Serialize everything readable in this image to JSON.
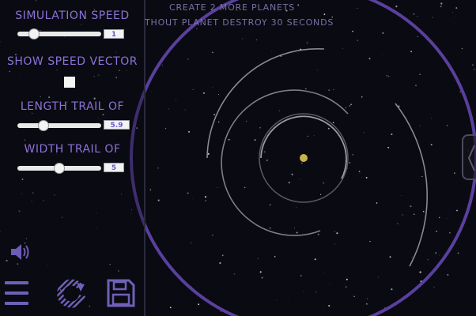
{
  "hint": {
    "line1": "CREATE 2 MORE PLANETS",
    "line2": "THOUT PLANET DESTROY 30 SECONDS"
  },
  "sim_speed": {
    "label": "SIMULATION SPEED",
    "value": "1",
    "level": 0.15
  },
  "speed_vector": {
    "label": "SHOW SPEED VECTOR",
    "checked": false
  },
  "trail_length": {
    "label": "LENGTH TRAIL OF",
    "value": "5.9",
    "level": 0.3
  },
  "trail_width": {
    "label": "WIDTH TRAIL OF",
    "value": "5",
    "level": 0.5
  },
  "icons": {
    "volume": "speaker-icon",
    "menu": "menu-icon",
    "reset": "reset-icon",
    "save": "save-icon",
    "handle": "chevron-left-icon"
  },
  "colors": {
    "accent": "#8c72d8",
    "boundary": "#5a3f9e",
    "orbit": "#9a9aa6",
    "star": "#c9b24a"
  }
}
